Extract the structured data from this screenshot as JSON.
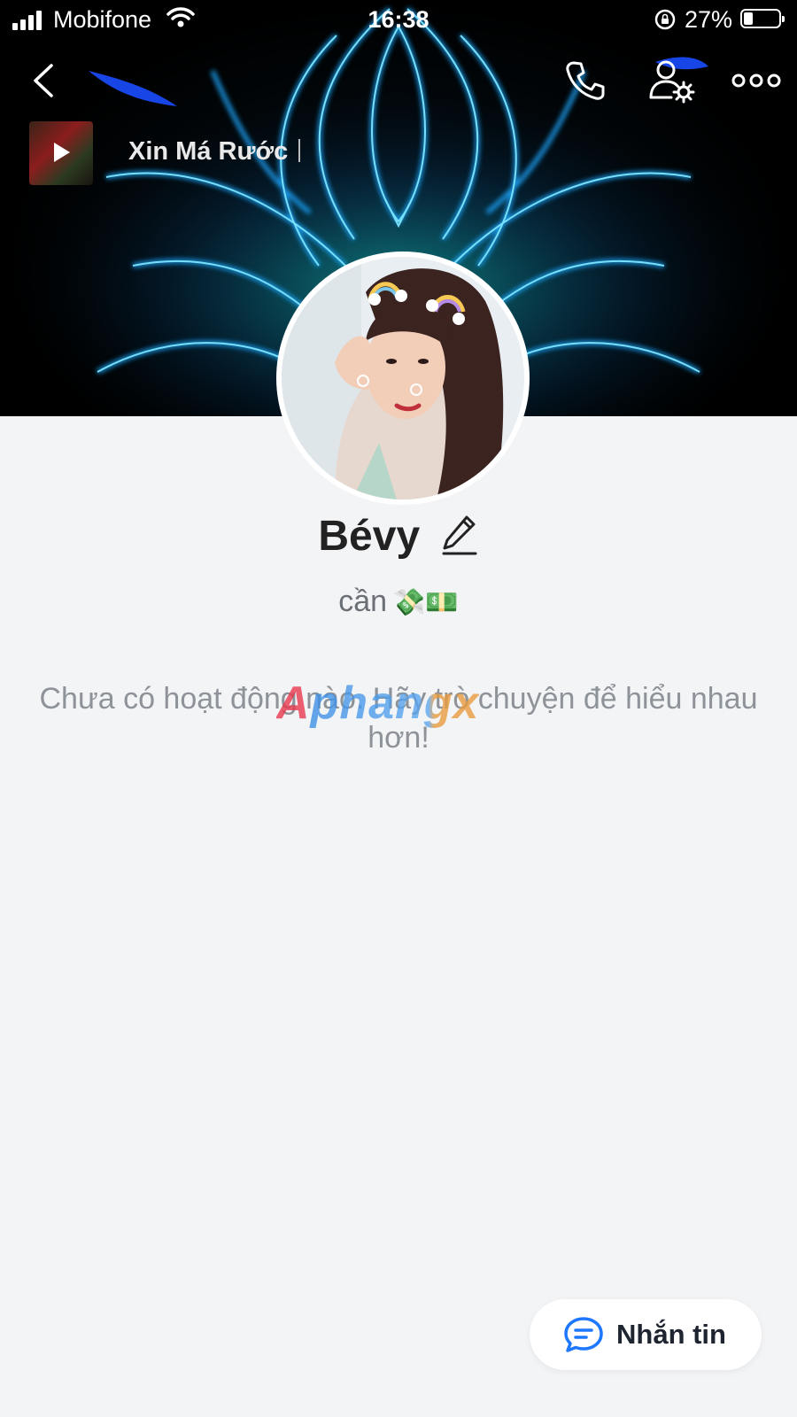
{
  "status_bar": {
    "carrier": "Mobifone",
    "time": "16:38",
    "battery_percent": "27%",
    "battery_level": 0.27
  },
  "nav": {
    "back_icon": "chevron-left-icon",
    "call_icon": "phone-icon",
    "settings_icon": "user-settings-icon",
    "more_icon": "more-dots-icon"
  },
  "music": {
    "title": "Xin Má Rước",
    "play_icon": "play-icon"
  },
  "profile": {
    "name": "Bévy",
    "status": "cần",
    "status_emojis": "💸💵",
    "edit_icon": "pencil-icon"
  },
  "empty_state": {
    "message": "Chưa có hoạt động nào. Hãy trò chuyện để hiểu nhau hơn!"
  },
  "watermark": {
    "text": "Aphangx"
  },
  "actions": {
    "message_label": "Nhắn tin",
    "message_icon": "chat-bubble-icon"
  },
  "colors": {
    "background": "#f3f4f6",
    "accent": "#1e78ff",
    "cover_glow": "#1aa8ff"
  }
}
